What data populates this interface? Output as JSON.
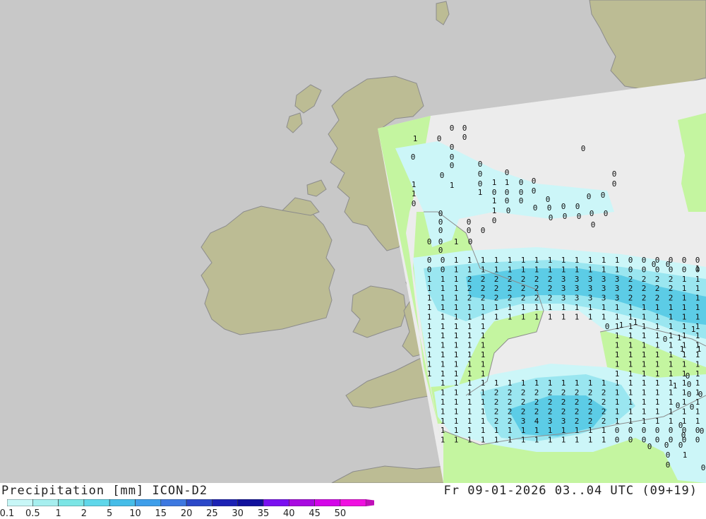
{
  "map": {
    "colors": {
      "sea": "#c8c8c8",
      "land": "#bcbc94",
      "coast": "#8c8c8c",
      "domain_background": "#ececec",
      "green_shade": "#c4f5a0",
      "light_blue": "#ccf6f8",
      "cyan": "#9ae6f0",
      "blue": "#5ccce6"
    },
    "grid_values": [
      "0",
      "1",
      "2",
      "3",
      "4"
    ]
  },
  "footer": {
    "title_left": "Precipitation [mm] ICON-D2",
    "title_right": "Fr 09-01-2026 03..04 UTC (09+19)",
    "legend": {
      "labels": [
        "0.1",
        "0.5",
        "1",
        "2",
        "5",
        "10",
        "15",
        "20",
        "25",
        "30",
        "35",
        "40",
        "45",
        "50"
      ],
      "colors": [
        "#c8f7f7",
        "#a6efef",
        "#7be5e5",
        "#5fd7ea",
        "#46bde8",
        "#3e9eea",
        "#3d78e0",
        "#2b48c8",
        "#1c22b4",
        "#10109c",
        "#7a10f0",
        "#a80ae0",
        "#d405e8",
        "#f010e0",
        "#c010b8"
      ]
    }
  }
}
